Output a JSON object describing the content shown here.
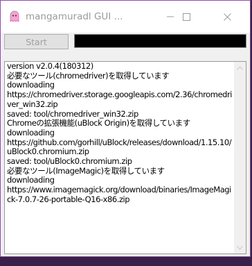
{
  "window": {
    "title": "mangamuradl GUI ...",
    "app_icon": "pink-ghost-icon"
  },
  "toolbar": {
    "start_label": "Start",
    "progress": 0
  },
  "log": {
    "lines": [
      "version v2.0.4(180312)",
      "必要なツール(chromedriver)を取得しています",
      "downloading",
      "https://chromedriver.storage.googleapis.com/2.36/chromedriver_win32.zip",
      "saved: tool/chromedriver_win32.zip",
      "Chromeの拡張機能(uBlock Origin)を取得しています",
      "downloading",
      "https://github.com/gorhill/uBlock/releases/download/1.15.10/uBlock0.chromium.zip",
      "saved: tool/uBlock0.chromium.zip",
      "必要なツール(ImageMagic)を取得しています",
      "downloading",
      "https://www.imagemagick.org/download/binaries/ImageMagick-7.0.7-26-portable-Q16-x86.zip"
    ]
  }
}
